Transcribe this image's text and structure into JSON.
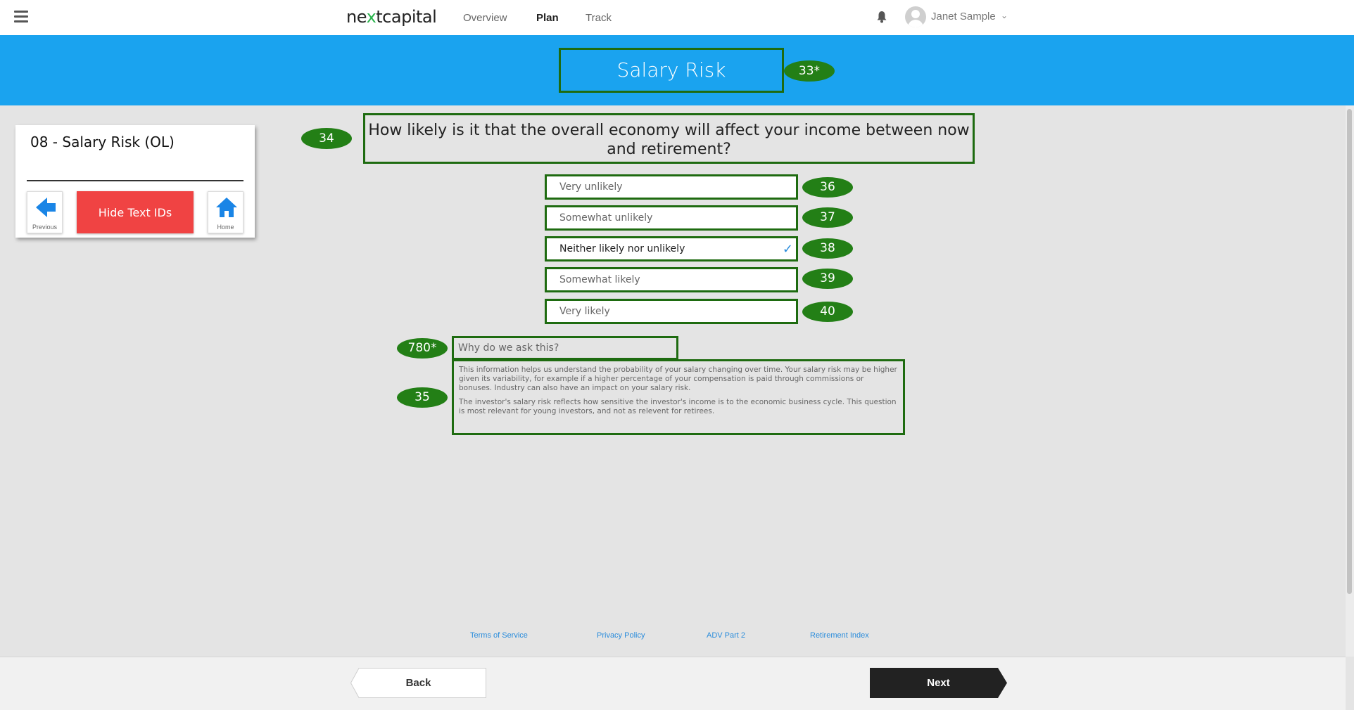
{
  "header": {
    "logo_part1": "ne",
    "logo_x": "x",
    "logo_part2": "tcapital",
    "nav": [
      "Overview",
      "Plan",
      "Track"
    ],
    "active_nav": "Plan",
    "user_name": "Janet Sample"
  },
  "banner": {
    "title": "Salary Risk",
    "title_id": "33*"
  },
  "panel": {
    "title": "08 - Salary Risk (OL)",
    "previous_label": "Previous",
    "hide_button_label": "Hide Text IDs",
    "home_label": "Home"
  },
  "question": {
    "id": "34",
    "text": "How likely is it that the overall economy will affect your income between now and retirement?"
  },
  "options": [
    {
      "label": "Very unlikely",
      "id": "36",
      "selected": false
    },
    {
      "label": "Somewhat unlikely",
      "id": "37",
      "selected": false
    },
    {
      "label": "Neither likely nor unlikely",
      "id": "38",
      "selected": true
    },
    {
      "label": "Somewhat likely",
      "id": "39",
      "selected": false
    },
    {
      "label": "Very likely",
      "id": "40",
      "selected": false
    }
  ],
  "why": {
    "header_id": "780*",
    "header": "Why do we ask this?",
    "body_id": "35",
    "paragraph1": "This information helps us understand the probability of your salary changing over time. Your salary risk may be higher given its variability, for example if a higher percentage of your compensation is paid through commissions or bonuses. Industry can also have an impact on your salary risk.",
    "paragraph2": "The investor's salary risk reflects how sensitive the investor's income is to the economic business cycle. This question is most relevant for young investors, and not as relevent for retirees."
  },
  "footer_links": [
    "Terms of Service",
    "Privacy Policy",
    "ADV Part 2",
    "Retirement Index"
  ],
  "buttons": {
    "back": "Back",
    "next": "Next"
  },
  "colors": {
    "banner": "#1aa3ef",
    "id_badge": "#237f16",
    "outline": "#1e6b10",
    "hide_button": "#f04343",
    "link": "#2a8cdb",
    "next_button": "#222222"
  }
}
